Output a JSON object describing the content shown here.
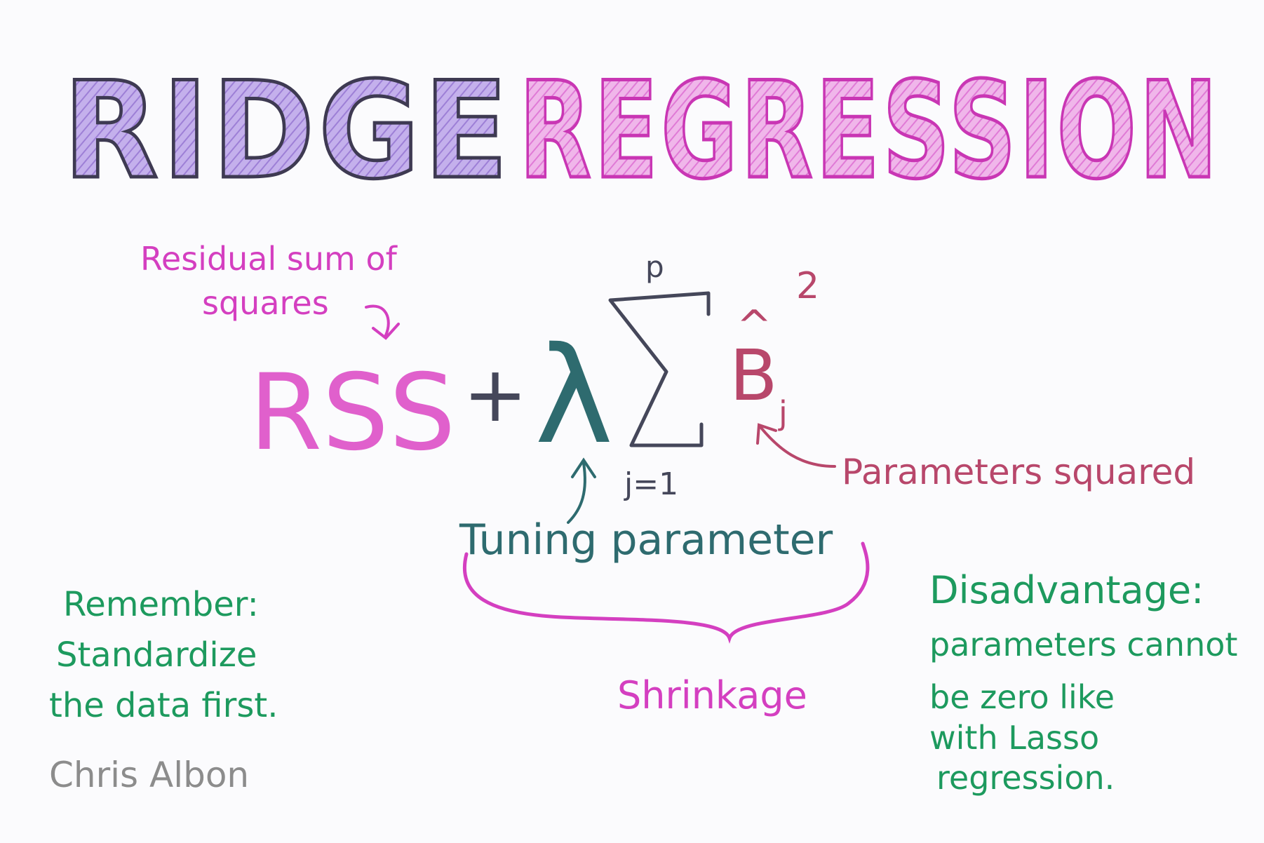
{
  "title": {
    "word1": "RIDGE",
    "word2": "REGRESSION",
    "word1_color": "#a78bdb",
    "word2_color": "#e07ad6",
    "outline_dark": "#3e3a52",
    "outline_pink": "#c936b4"
  },
  "equation": {
    "rss": "RSS",
    "plus": "+",
    "lambda": "λ",
    "sigma": "Σ",
    "sum_upper": "p",
    "sum_lower": "j=1",
    "beta": "B",
    "beta_hat": "^",
    "beta_sub": "j",
    "exponent": "2"
  },
  "annotations": {
    "rss_line1": "Residual sum of",
    "rss_line2": "squares",
    "tuning": "Tuning parameter",
    "params_squared": "Parameters squared",
    "shrinkage": "Shrinkage",
    "remember_title": "Remember:",
    "remember_line1": "Standardize",
    "remember_line2": "the data first.",
    "disadvantage_title": "Disadvantage:",
    "disadvantage_line1": "parameters cannot",
    "disadvantage_line2": "be zero like",
    "disadvantage_line3": "with Lasso",
    "disadvantage_line4": "regression."
  },
  "author": "Chris Albon",
  "colors": {
    "pink": "#d43fc0",
    "teal": "#2e6b6f",
    "dark": "#45475a",
    "red": "#b8476b",
    "green": "#1d9a5e",
    "gray": "#8c8c8c"
  }
}
